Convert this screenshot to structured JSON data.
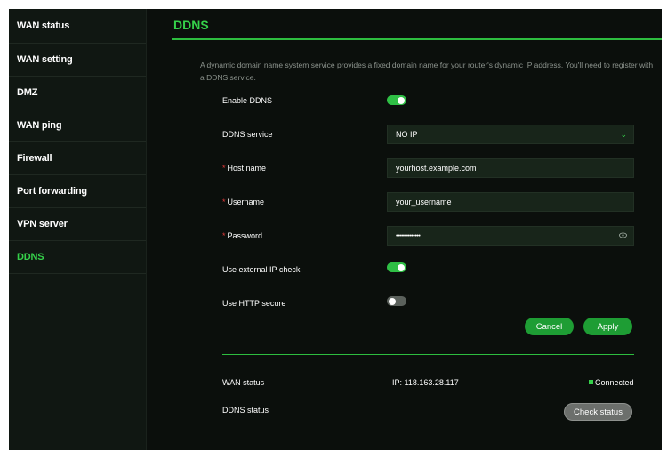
{
  "sidebar": {
    "items": [
      {
        "label": "WAN status"
      },
      {
        "label": "WAN setting"
      },
      {
        "label": "DMZ"
      },
      {
        "label": "WAN ping"
      },
      {
        "label": "Firewall"
      },
      {
        "label": "Port forwarding"
      },
      {
        "label": "VPN server"
      },
      {
        "label": "DDNS"
      }
    ],
    "active": "DDNS"
  },
  "page": {
    "title": "DDNS",
    "description": "A dynamic domain name system service provides a fixed domain name for your router's dynamic IP address. You'll need to register with a DDNS service."
  },
  "form": {
    "enable_ddns": {
      "label": "Enable DDNS",
      "on": true
    },
    "ddns_service": {
      "label": "DDNS service",
      "value": "NO IP"
    },
    "host_name": {
      "label": "Host name",
      "value": "yourhost.example.com",
      "required_mark": "*"
    },
    "username": {
      "label": "Username",
      "value": "your_username",
      "required_mark": "*"
    },
    "password": {
      "label": "Password",
      "value": "••••••••••••••",
      "required_mark": "*"
    },
    "external_ip_check": {
      "label": "Use external IP check",
      "on": true
    },
    "http_secure": {
      "label": "Use HTTP secure",
      "on": false
    },
    "cancel_label": "Cancel",
    "apply_label": "Apply"
  },
  "status": {
    "wan_label": "WAN status",
    "wan_ip": "IP: 118.163.28.117",
    "wan_state": "Connected",
    "ddns_label": "DDNS status",
    "check_label": "Check status"
  },
  "colors": {
    "accent": "#35d04a",
    "background": "#0b0f0c",
    "sidebar": "#101712",
    "required": "#e03a3a"
  }
}
